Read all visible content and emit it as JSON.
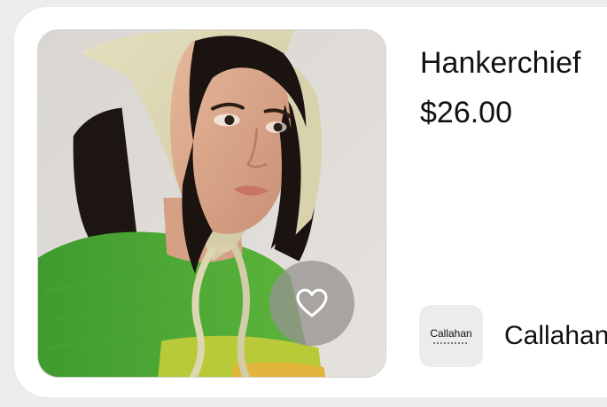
{
  "product": {
    "title": "Hankerchief",
    "price": "$26.00"
  },
  "brand": {
    "logo_text": "Callahan",
    "name": "Callahan"
  },
  "icons": {
    "favorite": "heart-icon"
  },
  "colors": {
    "card_background": "#ffffff",
    "page_background": "#ececec",
    "favorite_button": "#969491",
    "text": "#111111"
  }
}
